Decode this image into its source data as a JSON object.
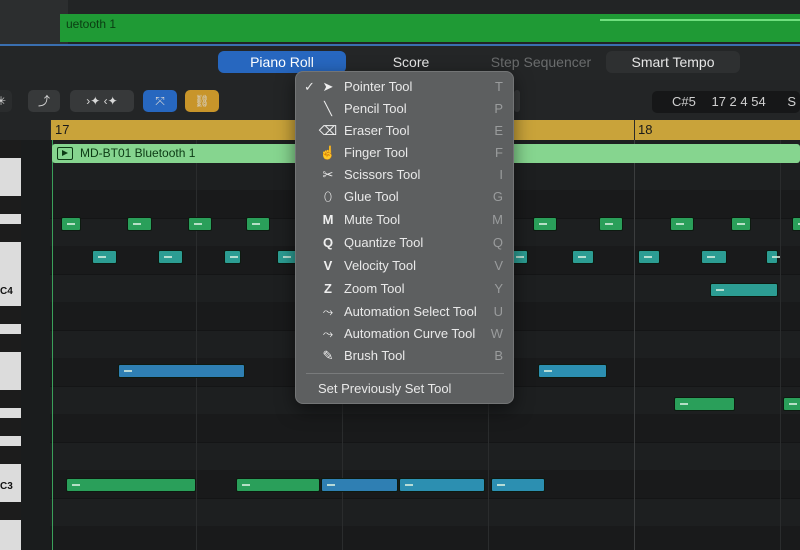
{
  "top_track": {
    "region_label": "uetooth 1"
  },
  "tabs": [
    {
      "label": "Piano Roll"
    },
    {
      "label": "Score"
    },
    {
      "label": "Step Sequencer"
    },
    {
      "label": "Smart Tempo"
    }
  ],
  "toolbar": {
    "position_note": "C#5",
    "position_time": "17 2 4 54",
    "cut_off": "S"
  },
  "ruler": {
    "bar_a": "17",
    "bar_b": "18"
  },
  "region": {
    "label": "MD-BT01 Bluetooth 1"
  },
  "keys": {
    "c4": "C4",
    "c3": "C3"
  },
  "tools_menu": {
    "selected_index": 0,
    "items": [
      {
        "label": "Pointer Tool",
        "shortcut": "T",
        "icon": "pointer-icon"
      },
      {
        "label": "Pencil Tool",
        "shortcut": "P",
        "icon": "pencil-icon"
      },
      {
        "label": "Eraser Tool",
        "shortcut": "E",
        "icon": "eraser-icon"
      },
      {
        "label": "Finger Tool",
        "shortcut": "F",
        "icon": "finger-icon"
      },
      {
        "label": "Scissors Tool",
        "shortcut": "I",
        "icon": "scissors-icon"
      },
      {
        "label": "Glue Tool",
        "shortcut": "G",
        "icon": "glue-icon"
      },
      {
        "label": "Mute Tool",
        "shortcut": "M",
        "icon": "mute-icon"
      },
      {
        "label": "Quantize Tool",
        "shortcut": "Q",
        "icon": "quantize-icon"
      },
      {
        "label": "Velocity Tool",
        "shortcut": "V",
        "icon": "velocity-icon"
      },
      {
        "label": "Zoom Tool",
        "shortcut": "Y",
        "icon": "zoom-icon"
      },
      {
        "label": "Automation Select Tool",
        "shortcut": "U",
        "icon": "automation-select-icon"
      },
      {
        "label": "Automation Curve Tool",
        "shortcut": "W",
        "icon": "automation-curve-icon"
      },
      {
        "label": "Brush Tool",
        "shortcut": "B",
        "icon": "brush-icon"
      }
    ],
    "footer": "Set Previously Set Tool",
    "icon_glyphs": {
      "check": "✓",
      "pointer": "➤",
      "pencil": "╲",
      "eraser": "⌫",
      "finger": "☝",
      "scissors": "✂",
      "glue": "⬯",
      "mute": "M",
      "quantize": "Q",
      "velocity": "V",
      "zoom": "Z",
      "auto_sel": "⤳",
      "auto_curve": "⤳",
      "brush": "✎"
    }
  },
  "colors": {
    "accent": "#2767bf",
    "region_green": "#86d58f",
    "ruler": "#c9a33a",
    "note_green": "#2a9f5a",
    "note_blue": "#2f7fb3"
  }
}
